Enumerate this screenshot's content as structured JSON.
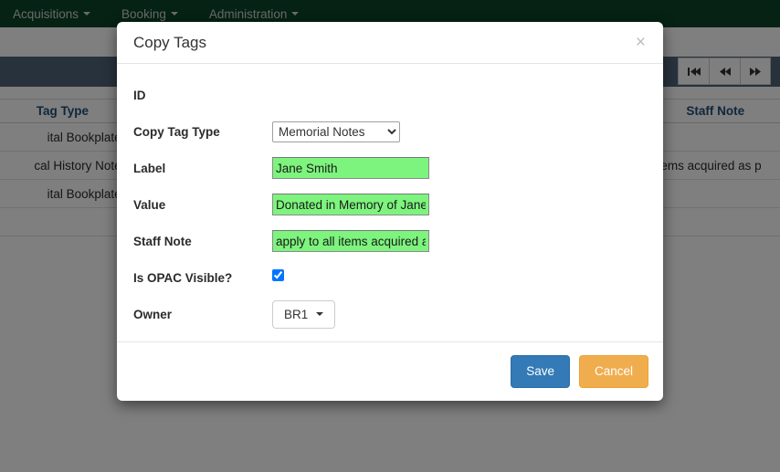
{
  "navbar": {
    "items": [
      {
        "label": "Acquisitions",
        "has_caret": true
      },
      {
        "label": "Booking",
        "has_caret": true
      },
      {
        "label": "Administration",
        "has_caret": true
      }
    ]
  },
  "pager": {
    "buttons": [
      {
        "name": "first-page",
        "glyph": "⏮"
      },
      {
        "name": "previous-page",
        "glyph": "◀◀"
      },
      {
        "name": "next-page",
        "glyph": "▶▶"
      }
    ]
  },
  "background_table": {
    "headers": {
      "tag_type": "Tag Type",
      "staff_note": "Staff Note"
    },
    "rows": [
      {
        "tag_type": "ital Bookplate",
        "staff_note": ""
      },
      {
        "tag_type": "cal History Note",
        "staff_note": "items acquired as p"
      },
      {
        "tag_type": "ital Bookplate",
        "staff_note": ""
      }
    ]
  },
  "modal": {
    "title": "Copy Tags",
    "close_label": "×",
    "fields": {
      "id": {
        "label": "ID",
        "value": ""
      },
      "copy_tag_type": {
        "label": "Copy Tag Type",
        "value": "Memorial Notes",
        "options": [
          "Memorial Notes"
        ]
      },
      "label": {
        "label": "Label",
        "value": "Jane Smith",
        "placeholder": ""
      },
      "value": {
        "label": "Value",
        "value": "Donated in Memory of Jane Smith",
        "placeholder": ""
      },
      "staff_note": {
        "label": "Staff Note",
        "value": "apply to all items acquired a",
        "placeholder": ""
      },
      "is_opac_visible": {
        "label": "Is OPAC Visible?",
        "checked": true
      },
      "owner": {
        "label": "Owner",
        "value": "BR1"
      }
    },
    "footer": {
      "save_label": "Save",
      "cancel_label": "Cancel"
    }
  },
  "colors": {
    "navbar_green": "#0b4429",
    "subbar_blue": "#51647a",
    "autofill_green": "#7df47d",
    "save_blue": "#337ab7",
    "cancel_orange": "#f0ad4e",
    "header_text_blue": "#1f4e79"
  }
}
